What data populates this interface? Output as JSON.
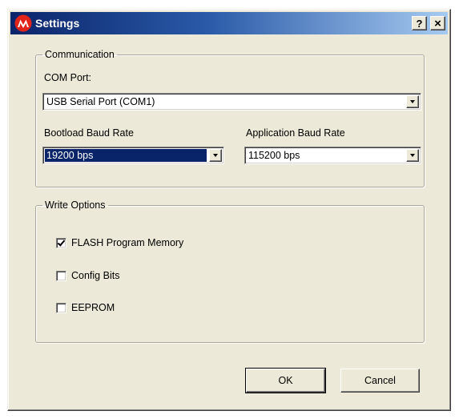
{
  "window": {
    "title": "Settings",
    "app_icon": "microchip-logo-icon",
    "help_label": "?",
    "close_label": "×"
  },
  "communication": {
    "legend": "Communication",
    "com_port": {
      "label": "COM Port:",
      "value": "USB Serial Port (COM1)"
    },
    "bootload_baud": {
      "label": "Bootload Baud Rate",
      "value": "19200 bps"
    },
    "application_baud": {
      "label": "Application Baud Rate",
      "value": "115200 bps"
    }
  },
  "write_options": {
    "legend": "Write Options",
    "items": [
      {
        "label": "FLASH Program Memory",
        "checked": true
      },
      {
        "label": "Config Bits",
        "checked": false
      },
      {
        "label": "EEPROM",
        "checked": false
      }
    ]
  },
  "buttons": {
    "ok": "OK",
    "cancel": "Cancel"
  },
  "colors": {
    "titlebar_start": "#0a246a",
    "titlebar_end": "#a6caf0",
    "dialog_face": "#ece9d8",
    "selection": "#0a246a",
    "logo_red": "#e2231a"
  }
}
